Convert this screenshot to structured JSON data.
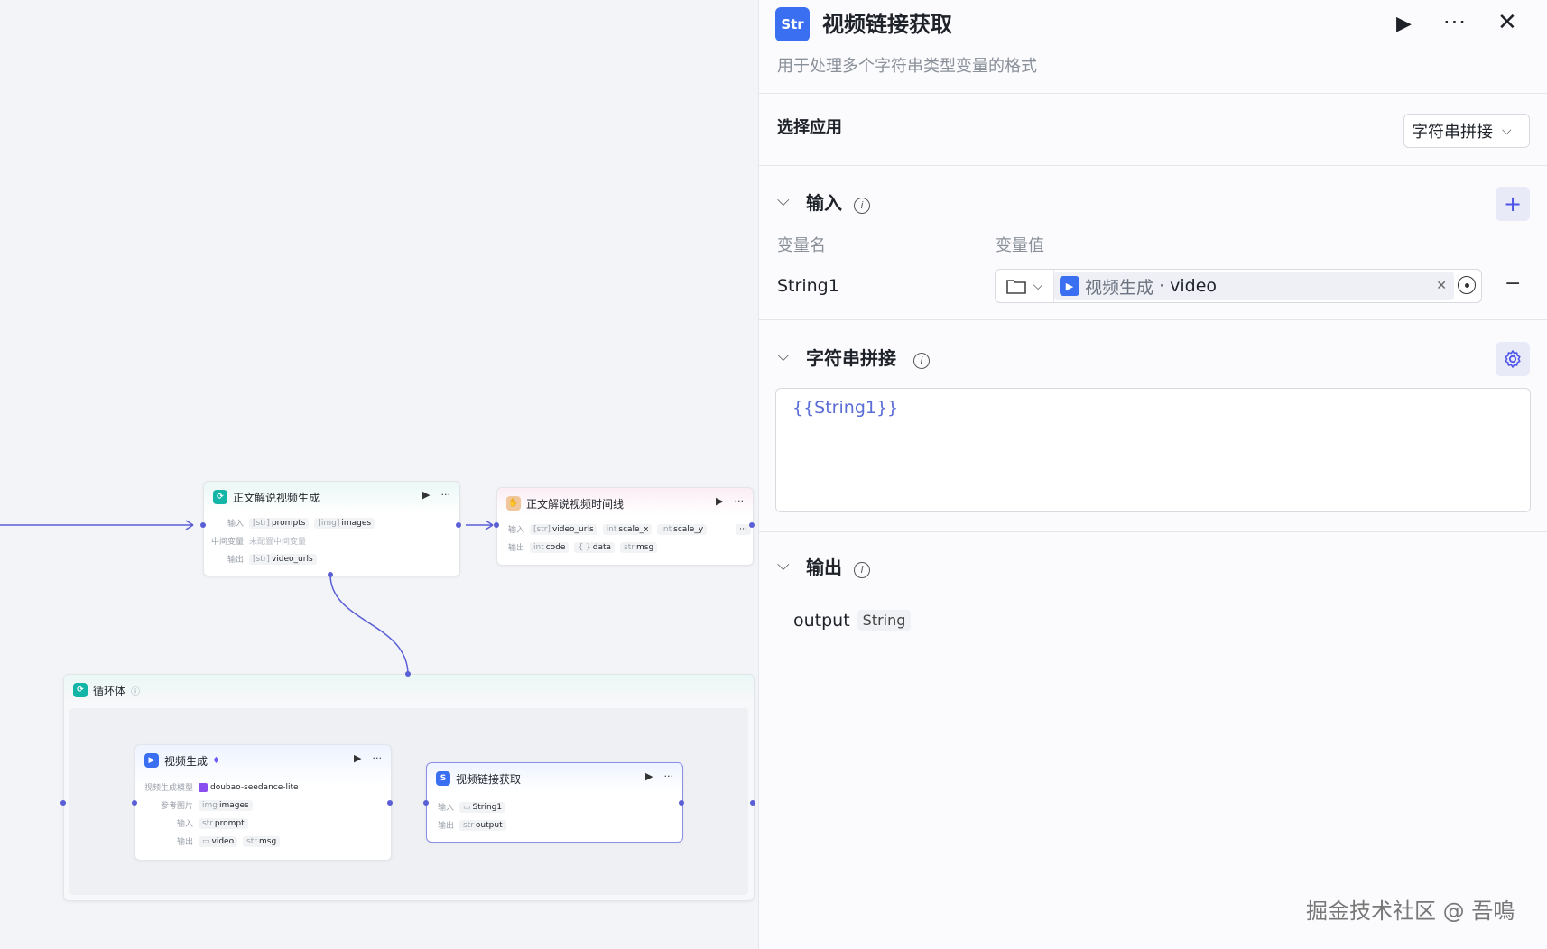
{
  "canvas": {
    "node_main": {
      "title": "正文解说视频生成",
      "row_input_label": "输入",
      "row_input_tags": [
        {
          "type": "[str]",
          "name": "prompts"
        },
        {
          "type": "[img]",
          "name": "images"
        }
      ],
      "row_mid_label": "中间变量",
      "row_mid_value": "未配置中间变量",
      "row_output_label": "输出",
      "row_output_tags": [
        {
          "type": "[str]",
          "name": "video_urls"
        }
      ]
    },
    "node_timeline": {
      "title": "正文解说视频时间线",
      "row_input_label": "输入",
      "row_input_tags": [
        {
          "type": "[str]",
          "name": "video_urls"
        },
        {
          "type": "int",
          "name": "scale_x"
        },
        {
          "type": "int",
          "name": "scale_y"
        }
      ],
      "row_input_more": "···",
      "row_output_label": "输出",
      "row_output_tags": [
        {
          "type": "int",
          "name": "code"
        },
        {
          "type": "{ }",
          "name": "data"
        },
        {
          "type": "str",
          "name": "msg"
        }
      ]
    },
    "loop": {
      "title": "循环体"
    },
    "node_video": {
      "title": "视频生成",
      "row_model_label": "视频生成模型",
      "row_model_value": "doubao-seedance-lite",
      "row_ref_label": "参考图片",
      "row_ref_tags": [
        {
          "type": "img",
          "name": "images"
        }
      ],
      "row_input_label": "输入",
      "row_input_tags": [
        {
          "type": "str",
          "name": "prompt"
        }
      ],
      "row_output_label": "输出",
      "row_output_tags": [
        {
          "type": "▭",
          "name": "video"
        },
        {
          "type": "str",
          "name": "msg"
        }
      ]
    },
    "node_link": {
      "title": "视频链接获取",
      "row_input_label": "输入",
      "row_input_tags": [
        {
          "type": "▭",
          "name": "String1"
        }
      ],
      "row_output_label": "输出",
      "row_output_tags": [
        {
          "type": "str",
          "name": "output"
        }
      ]
    }
  },
  "panel": {
    "title": "视频链接获取",
    "description": "用于处理多个字符串类型变量的格式",
    "select_app_label": "选择应用",
    "select_app_value": "字符串拼接",
    "input_section": "输入",
    "col_name": "变量名",
    "col_value": "变量值",
    "var_name": "String1",
    "var_ref_node": "视频生成",
    "var_ref_sep": " · ",
    "var_ref_field": "video",
    "concat_section": "字符串拼接",
    "concat_template": "{{String1}}",
    "output_section": "输出",
    "output_name": "output",
    "output_type": "String"
  },
  "watermark": "掘金技术社区 @ 吾鳴",
  "colors": {
    "accent": "#4d53e8",
    "teal": "#13b5a6",
    "blue": "#3a6ff2",
    "edge": "#5b5fd6"
  }
}
